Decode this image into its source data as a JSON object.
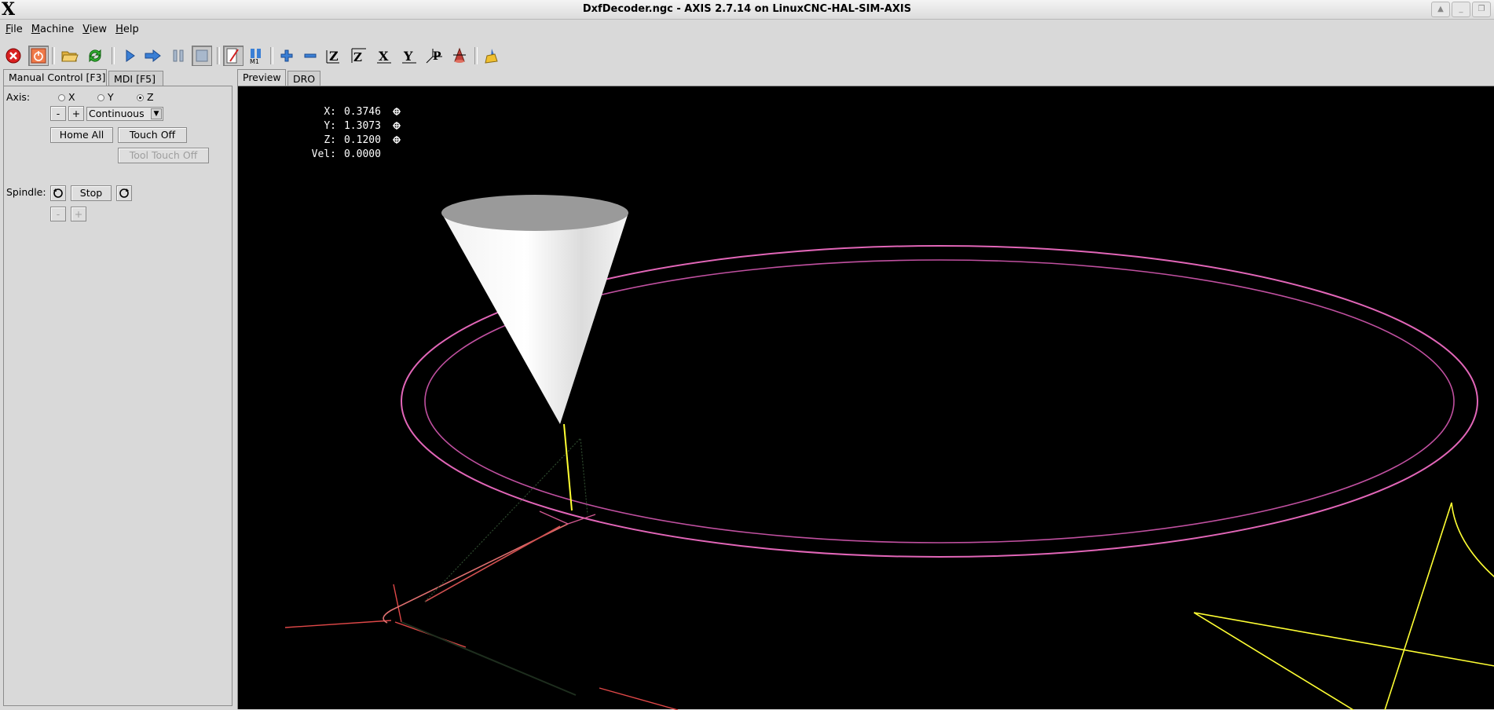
{
  "window": {
    "title": "DxfDecoder.ngc - AXIS 2.7.14 on LinuxCNC-HAL-SIM-AXIS",
    "logo": "X",
    "buttons": [
      "maximize-icon",
      "minimize-icon",
      "restore-icon"
    ]
  },
  "menu": [
    {
      "first": "F",
      "rest": "ile"
    },
    {
      "first": "M",
      "rest": "achine"
    },
    {
      "first": "V",
      "rest": "iew"
    },
    {
      "first": "H",
      "rest": "elp"
    }
  ],
  "toolbar": {
    "icons": [
      "estop-icon",
      "machine-power-icon",
      "open-file-icon",
      "reload-icon",
      "run-icon",
      "step-icon",
      "pause-icon",
      "stop-icon",
      "block-delete-icon",
      "optional-stop-icon",
      "zoom-in-icon",
      "zoom-out-icon",
      "view-z-icon",
      "view-z2-icon",
      "view-x-icon",
      "view-y-icon",
      "view-p-icon",
      "rotate-view-icon",
      "clear-plot-icon"
    ]
  },
  "left_tabs": [
    "Manual Control [F3]",
    "MDI [F5]"
  ],
  "manual": {
    "axis_label": "Axis:",
    "axes": [
      "X",
      "Y",
      "Z"
    ],
    "selected_axis": "Z",
    "jog_minus": "-",
    "jog_plus": "+",
    "jog_mode": "Continuous",
    "home_all": "Home All",
    "touch_off": "Touch Off",
    "tool_touch_off": "Tool Touch Off",
    "spindle_label": "Spindle:",
    "spindle_stop": "Stop",
    "spindle_minus": "-",
    "spindle_plus": "+"
  },
  "right_tabs": [
    "Preview",
    "DRO"
  ],
  "dro": [
    {
      "label": "X:",
      "value": "0.3746",
      "homed": true
    },
    {
      "label": "Y:",
      "value": "1.3073",
      "homed": true
    },
    {
      "label": "Z:",
      "value": "0.1200",
      "homed": true
    },
    {
      "label": "Vel:",
      "value": "0.0000",
      "homed": false
    }
  ],
  "colors": {
    "background": "#000000",
    "toolpath_feed": "#e266b8",
    "toolpath_rapid": "#e04848",
    "current_segment": "#ffff33",
    "tool_cone": "#ffffff",
    "estop_red": "#d92020"
  }
}
